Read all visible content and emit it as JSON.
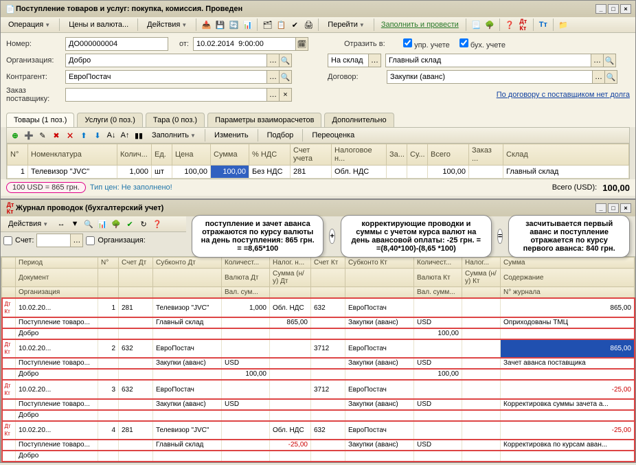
{
  "title": "Поступление товаров и услуг: покупка, комиссия. Проведен",
  "toolbar1": {
    "operation": "Операция",
    "prices": "Цены и валюта...",
    "actions": "Действия",
    "go": "Перейти",
    "fill_post": "Заполнить и провести"
  },
  "form": {
    "number_label": "Номер:",
    "number": "ДО000000004",
    "date_label": "от:",
    "date": "10.02.2014  9:00:00",
    "reflect_label": "Отразить в:",
    "chk_upr": "упр. учете",
    "chk_buh": "бух. учете",
    "org_label": "Организация:",
    "org": "Добро",
    "wh_label": "На склад",
    "wh": "Главный склад",
    "contr_label": "Контрагент:",
    "contr": "ЕвроПостач",
    "dogovor_label": "Договор:",
    "dogovor": "Закупки (аванс)",
    "order_label": "Заказ поставщику:",
    "no_debt": "По договору с поставщиком нет долга"
  },
  "tabs": [
    "Товары (1 поз.)",
    "Услуги (0 поз.)",
    "Тара (0 поз.)",
    "Параметры взаиморасчетов",
    "Дополнительно"
  ],
  "grid_tb": {
    "fill": "Заполнить",
    "change": "Изменить",
    "select": "Подбор",
    "reval": "Переоценка"
  },
  "grid": {
    "cols": [
      "N°",
      "Номенклатура",
      "Колич...",
      "Ед.",
      "Цена",
      "Сумма",
      "% НДС",
      "Счет учета",
      "Налоговое н...",
      "За...",
      "Су...",
      "Всего",
      "Заказ ...",
      "Склад"
    ],
    "row": {
      "n": "1",
      "nomen": "Телевизор \"JVC\"",
      "qty": "1,000",
      "unit": "шт",
      "price": "100,00",
      "sum": "100,00",
      "vat": "Без НДС",
      "acct": "281",
      "tax": "Обл. НДС",
      "total": "100,00",
      "sklad": "Главный склад"
    }
  },
  "bottom": {
    "pill": "100 USD = 865 грн.",
    "info": "Тип цен: Не заполнено!",
    "total_label": "Всего (USD):",
    "total": "100,00"
  },
  "journal": {
    "title": "Журнал проводок (бухгалтерский учет)",
    "actions": "Действия",
    "filter": {
      "acct": "Счет:",
      "org": "Организация:"
    },
    "head1": [
      "",
      "Период",
      "N°",
      "Счет Дт",
      "Субконто Дт",
      "Количест...",
      "Налог. н...",
      "Счет Кт",
      "Субконто Кт",
      "Количест...",
      "Налог...",
      "Сумма"
    ],
    "head2": [
      "",
      "Документ",
      "",
      "",
      "",
      "Валюта Дт",
      "Сумма (н/у) Дт",
      "",
      "",
      "Валюта Кт",
      "Сумма (н/у) Кт",
      "Содержание"
    ],
    "head3": [
      "",
      "Организация",
      "",
      "",
      "",
      "Вал. сум...",
      "",
      "",
      "",
      "Вал. сумм...",
      "",
      "N° журнала"
    ],
    "rows": [
      {
        "a": [
          "",
          "10.02.20...",
          "1",
          "281",
          "Телевизор \"JVC\"",
          "1,000",
          "Обл. НДС",
          "632",
          "ЕвроПостач",
          "",
          "",
          "865,00"
        ],
        "cls": [
          "",
          "",
          "num",
          "",
          "",
          "num",
          "",
          "",
          "",
          "",
          "",
          "num"
        ]
      },
      {
        "a": [
          "",
          "Поступление товаро...",
          "",
          "",
          "Главный склад",
          "",
          "865,00",
          "",
          "Закупки (аванс)",
          "USD",
          "",
          "Оприходованы ТМЦ"
        ],
        "cls": [
          "",
          "",
          "",
          "",
          "",
          "",
          "num",
          "",
          "",
          "",
          "",
          ""
        ]
      },
      {
        "a": [
          "",
          "Добро",
          "",
          "",
          "",
          "",
          "",
          "",
          "",
          "100,00",
          "",
          ""
        ],
        "cls": [
          "",
          "",
          "",
          "",
          "",
          "",
          "",
          "",
          "",
          "num",
          "",
          ""
        ]
      },
      {
        "a": [
          "",
          "10.02.20...",
          "2",
          "632",
          "ЕвроПостач",
          "",
          "",
          "3712",
          "ЕвроПостач",
          "",
          "",
          "865,00"
        ],
        "cls": [
          "",
          "",
          "num",
          "",
          "",
          "",
          "",
          "",
          "",
          "",
          "",
          "seld"
        ]
      },
      {
        "a": [
          "",
          "Поступление товаро...",
          "",
          "",
          "Закупки (аванс)",
          "USD",
          "",
          "",
          "Закупки (аванс)",
          "USD",
          "",
          "Зачет аванса поставщика"
        ],
        "cls": [
          "",
          "",
          "",
          "",
          "",
          "",
          "",
          "",
          "",
          "",
          "",
          ""
        ]
      },
      {
        "a": [
          "",
          "Добро",
          "",
          "",
          "",
          "100,00",
          "",
          "",
          "",
          "100,00",
          "",
          ""
        ],
        "cls": [
          "",
          "",
          "",
          "",
          "",
          "num",
          "",
          "",
          "",
          "num",
          "",
          ""
        ]
      },
      {
        "a": [
          "",
          "10.02.20...",
          "3",
          "632",
          "ЕвроПостач",
          "",
          "",
          "3712",
          "ЕвроПостач",
          "",
          "",
          "-25,00"
        ],
        "cls": [
          "",
          "",
          "num",
          "",
          "",
          "",
          "",
          "",
          "",
          "",
          "",
          "neg"
        ]
      },
      {
        "a": [
          "",
          "Поступление товаро...",
          "",
          "",
          "Закупки (аванс)",
          "USD",
          "",
          "",
          "Закупки (аванс)",
          "USD",
          "",
          "Корректировка суммы зачета а..."
        ],
        "cls": [
          "",
          "",
          "",
          "",
          "",
          "",
          "",
          "",
          "",
          "",
          "",
          ""
        ]
      },
      {
        "a": [
          "",
          "Добро",
          "",
          "",
          "",
          "",
          "",
          "",
          "",
          "",
          "",
          ""
        ],
        "cls": [
          "",
          "",
          "",
          "",
          "",
          "",
          "",
          "",
          "",
          "",
          "",
          ""
        ]
      },
      {
        "a": [
          "",
          "10.02.20...",
          "4",
          "281",
          "Телевизор \"JVC\"",
          "",
          "Обл. НДС",
          "632",
          "ЕвроПостач",
          "",
          "",
          "-25,00"
        ],
        "cls": [
          "",
          "",
          "num",
          "",
          "",
          "",
          "",
          "",
          "",
          "",
          "",
          "neg"
        ]
      },
      {
        "a": [
          "",
          "Поступление товаро...",
          "",
          "",
          "Главный склад",
          "",
          "-25,00",
          "",
          "Закупки (аванс)",
          "USD",
          "",
          "Корректировка по курсам аван..."
        ],
        "cls": [
          "",
          "",
          "",
          "",
          "",
          "",
          "neg",
          "",
          "",
          "",
          "",
          ""
        ]
      },
      {
        "a": [
          "",
          "Добро",
          "",
          "",
          "",
          "",
          "",
          "",
          "",
          "",
          "",
          ""
        ],
        "cls": [
          "",
          "",
          "",
          "",
          "",
          "",
          "",
          "",
          "",
          "",
          "",
          ""
        ]
      }
    ]
  },
  "annot": {
    "b1": "поступление и зачет аванса отражаются по курсу валюты на день поступления: 865 грн. = =8,65*100",
    "b2": "корректирующие проводки и суммы с учетом курса валют на день авансовой оплаты: -25 грн. = =(8,40*100)-(8,65 *100)",
    "b3": "засчитывается первый аванс и поступление отражается по курсу первого аванса: 840 грн.",
    "plus": "+",
    "eq": "="
  }
}
